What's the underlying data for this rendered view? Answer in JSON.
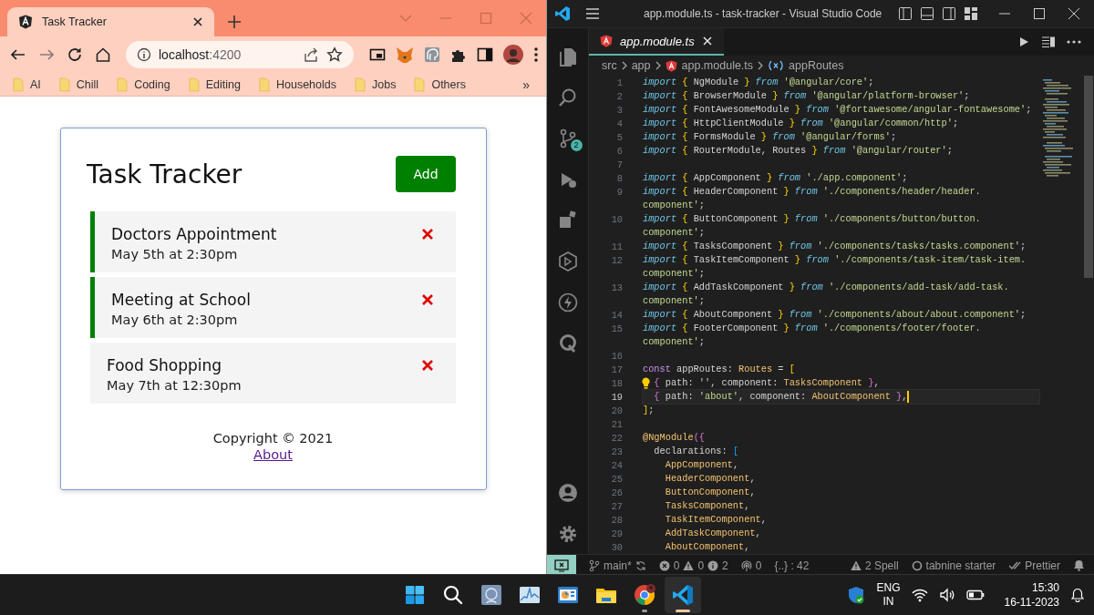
{
  "browser": {
    "tab": {
      "title": "Task Tracker"
    },
    "address": {
      "host": "localhost",
      "port": ":4200"
    },
    "bookmarks": [
      {
        "label": "AI"
      },
      {
        "label": "Chill"
      },
      {
        "label": "Coding"
      },
      {
        "label": "Editing"
      },
      {
        "label": "Households"
      },
      {
        "label": "Jobs"
      },
      {
        "label": "Others"
      }
    ],
    "bookmarks_more": "»",
    "app": {
      "title": "Task Tracker",
      "add_button": "Add",
      "tasks": [
        {
          "title": "Doctors Appointment",
          "date": "May 5th at 2:30pm",
          "reminder": true
        },
        {
          "title": "Meeting at School",
          "date": "May 6th at 2:30pm",
          "reminder": true
        },
        {
          "title": "Food Shopping",
          "date": "May 7th at 12:30pm",
          "reminder": false
        }
      ],
      "copyright": "Copyright © 2021",
      "about_link": "About"
    }
  },
  "vscode": {
    "title": "app.module.ts - task-tracker - Visual Studio Code",
    "scm_badge": "2",
    "tab": {
      "title": "app.module.ts"
    },
    "breadcrumbs": [
      {
        "label": "src",
        "kind": "folder"
      },
      {
        "label": "app",
        "kind": "folder"
      },
      {
        "label": "app.module.ts",
        "kind": "file"
      },
      {
        "label": "appRoutes",
        "kind": "symbol"
      }
    ],
    "editor": {
      "rows": [
        {
          "number": "1",
          "current": false,
          "lightbulb": false,
          "tokens": [
            {
              "kind": "keyword",
              "text": "import "
            },
            {
              "kind": "brace",
              "text": "{ "
            },
            {
              "kind": "plain",
              "text": "NgModule "
            },
            {
              "kind": "brace",
              "text": "} "
            },
            {
              "kind": "keyword",
              "text": "from "
            },
            {
              "kind": "string",
              "text": "'@angular/core'"
            },
            {
              "kind": "plain",
              "text": ";"
            }
          ]
        },
        {
          "number": "2",
          "current": false,
          "lightbulb": false,
          "tokens": [
            {
              "kind": "keyword",
              "text": "import "
            },
            {
              "kind": "brace",
              "text": "{ "
            },
            {
              "kind": "plain",
              "text": "BrowserModule "
            },
            {
              "kind": "brace",
              "text": "} "
            },
            {
              "kind": "keyword",
              "text": "from "
            },
            {
              "kind": "string",
              "text": "'@angular/platform-browser'"
            },
            {
              "kind": "plain",
              "text": ";"
            }
          ]
        },
        {
          "number": "3",
          "current": false,
          "lightbulb": false,
          "tokens": [
            {
              "kind": "keyword",
              "text": "import "
            },
            {
              "kind": "brace",
              "text": "{ "
            },
            {
              "kind": "plain",
              "text": "FontAwesomeModule "
            },
            {
              "kind": "brace",
              "text": "} "
            },
            {
              "kind": "keyword",
              "text": "from "
            },
            {
              "kind": "string",
              "text": "'@fortawesome/angular-fontawesome'"
            },
            {
              "kind": "plain",
              "text": ";"
            }
          ]
        },
        {
          "number": "4",
          "current": false,
          "lightbulb": false,
          "tokens": [
            {
              "kind": "keyword",
              "text": "import "
            },
            {
              "kind": "brace",
              "text": "{ "
            },
            {
              "kind": "plain",
              "text": "HttpClientModule "
            },
            {
              "kind": "brace",
              "text": "} "
            },
            {
              "kind": "keyword",
              "text": "from "
            },
            {
              "kind": "string",
              "text": "'@angular/common/http'"
            },
            {
              "kind": "plain",
              "text": ";"
            }
          ]
        },
        {
          "number": "5",
          "current": false,
          "lightbulb": false,
          "tokens": [
            {
              "kind": "keyword",
              "text": "import "
            },
            {
              "kind": "brace",
              "text": "{ "
            },
            {
              "kind": "plain",
              "text": "FormsModule "
            },
            {
              "kind": "brace",
              "text": "} "
            },
            {
              "kind": "keyword",
              "text": "from "
            },
            {
              "kind": "string",
              "text": "'@angular/forms'"
            },
            {
              "kind": "plain",
              "text": ";"
            }
          ]
        },
        {
          "number": "6",
          "current": false,
          "lightbulb": false,
          "tokens": [
            {
              "kind": "keyword",
              "text": "import "
            },
            {
              "kind": "brace",
              "text": "{ "
            },
            {
              "kind": "plain",
              "text": "RouterModule, Routes "
            },
            {
              "kind": "brace",
              "text": "} "
            },
            {
              "kind": "keyword",
              "text": "from "
            },
            {
              "kind": "string",
              "text": "'@angular/router'"
            },
            {
              "kind": "plain",
              "text": ";"
            }
          ]
        },
        {
          "number": "7",
          "current": false
        },
        {
          "number": "8",
          "current": false,
          "lightbulb": false,
          "tokens": [
            {
              "kind": "keyword",
              "text": "import "
            },
            {
              "kind": "brace",
              "text": "{ "
            },
            {
              "kind": "plain",
              "text": "AppComponent "
            },
            {
              "kind": "brace",
              "text": "} "
            },
            {
              "kind": "keyword",
              "text": "from "
            },
            {
              "kind": "string",
              "text": "'./app.component'"
            },
            {
              "kind": "plain",
              "text": ";"
            }
          ]
        },
        {
          "number": "9",
          "current": false,
          "lightbulb": false,
          "tokens": [
            {
              "kind": "keyword",
              "text": "import "
            },
            {
              "kind": "brace",
              "text": "{ "
            },
            {
              "kind": "plain",
              "text": "HeaderComponent "
            },
            {
              "kind": "brace",
              "text": "} "
            },
            {
              "kind": "keyword",
              "text": "from "
            },
            {
              "kind": "string",
              "text": "'./components/header/header."
            }
          ]
        },
        {
          "current": false,
          "lightbulb": false,
          "tokens": [
            {
              "kind": "string",
              "text": "component'"
            },
            {
              "kind": "plain",
              "text": ";"
            }
          ]
        },
        {
          "number": "10",
          "current": false,
          "lightbulb": false,
          "tokens": [
            {
              "kind": "keyword",
              "text": "import "
            },
            {
              "kind": "brace",
              "text": "{ "
            },
            {
              "kind": "plain",
              "text": "ButtonComponent "
            },
            {
              "kind": "brace",
              "text": "} "
            },
            {
              "kind": "keyword",
              "text": "from "
            },
            {
              "kind": "string",
              "text": "'./components/button/button."
            }
          ]
        },
        {
          "current": false,
          "lightbulb": false,
          "tokens": [
            {
              "kind": "string",
              "text": "component'"
            },
            {
              "kind": "plain",
              "text": ";"
            }
          ]
        },
        {
          "number": "11",
          "current": false,
          "lightbulb": false,
          "tokens": [
            {
              "kind": "keyword",
              "text": "import "
            },
            {
              "kind": "brace",
              "text": "{ "
            },
            {
              "kind": "plain",
              "text": "TasksComponent "
            },
            {
              "kind": "brace",
              "text": "} "
            },
            {
              "kind": "keyword",
              "text": "from "
            },
            {
              "kind": "string",
              "text": "'./components/tasks/tasks.component'"
            },
            {
              "kind": "plain",
              "text": ";"
            }
          ]
        },
        {
          "number": "12",
          "current": false,
          "lightbulb": false,
          "tokens": [
            {
              "kind": "keyword",
              "text": "import "
            },
            {
              "kind": "brace",
              "text": "{ "
            },
            {
              "kind": "plain",
              "text": "TaskItemComponent "
            },
            {
              "kind": "brace",
              "text": "} "
            },
            {
              "kind": "keyword",
              "text": "from "
            },
            {
              "kind": "string",
              "text": "'./components/task-item/task-item."
            }
          ]
        },
        {
          "current": false,
          "lightbulb": false,
          "tokens": [
            {
              "kind": "string",
              "text": "component'"
            },
            {
              "kind": "plain",
              "text": ";"
            }
          ]
        },
        {
          "number": "13",
          "current": false,
          "lightbulb": false,
          "tokens": [
            {
              "kind": "keyword",
              "text": "import "
            },
            {
              "kind": "brace",
              "text": "{ "
            },
            {
              "kind": "plain",
              "text": "AddTaskComponent "
            },
            {
              "kind": "brace",
              "text": "} "
            },
            {
              "kind": "keyword",
              "text": "from "
            },
            {
              "kind": "string",
              "text": "'./components/add-task/add-task."
            }
          ]
        },
        {
          "current": false,
          "lightbulb": false,
          "tokens": [
            {
              "kind": "string",
              "text": "component'"
            },
            {
              "kind": "plain",
              "text": ";"
            }
          ]
        },
        {
          "number": "14",
          "current": false,
          "lightbulb": false,
          "tokens": [
            {
              "kind": "keyword",
              "text": "import "
            },
            {
              "kind": "brace",
              "text": "{ "
            },
            {
              "kind": "plain",
              "text": "AboutComponent "
            },
            {
              "kind": "brace",
              "text": "} "
            },
            {
              "kind": "keyword",
              "text": "from "
            },
            {
              "kind": "string",
              "text": "'./components/about/about.component'"
            },
            {
              "kind": "plain",
              "text": ";"
            }
          ]
        },
        {
          "number": "15",
          "current": false,
          "lightbulb": false,
          "tokens": [
            {
              "kind": "keyword",
              "text": "import "
            },
            {
              "kind": "brace",
              "text": "{ "
            },
            {
              "kind": "plain",
              "text": "FooterComponent "
            },
            {
              "kind": "brace",
              "text": "} "
            },
            {
              "kind": "keyword",
              "text": "from "
            },
            {
              "kind": "string",
              "text": "'./components/footer/footer."
            }
          ]
        },
        {
          "current": false,
          "lightbulb": false,
          "tokens": [
            {
              "kind": "string",
              "text": "component'"
            },
            {
              "kind": "plain",
              "text": ";"
            }
          ]
        },
        {
          "number": "16",
          "current": false
        },
        {
          "number": "17",
          "current": false,
          "lightbulb": false,
          "tokens": [
            {
              "kind": "storage",
              "text": "const "
            },
            {
              "kind": "plain",
              "text": "appRoutes: "
            },
            {
              "kind": "type",
              "text": "Routes "
            },
            {
              "kind": "plain",
              "text": "= "
            },
            {
              "kind": "brace",
              "text": "["
            }
          ]
        },
        {
          "number": "18",
          "current": false,
          "lightbulb": true,
          "tokens": [
            {
              "kind": "brace2",
              "text": "  { "
            },
            {
              "kind": "plain",
              "text": "path: "
            },
            {
              "kind": "string",
              "text": "''"
            },
            {
              "kind": "plain",
              "text": ", component: "
            },
            {
              "kind": "type",
              "text": "TasksComponent "
            },
            {
              "kind": "brace2",
              "text": "}"
            },
            {
              "kind": "plain",
              "text": ","
            }
          ]
        },
        {
          "number": "19",
          "current": true,
          "lightbulb": false,
          "tokens": [
            {
              "kind": "brace2",
              "text": "  { "
            },
            {
              "kind": "plain",
              "text": "path: "
            },
            {
              "kind": "string",
              "text": "'about'"
            },
            {
              "kind": "plain",
              "text": ", component: "
            },
            {
              "kind": "type",
              "text": "AboutComponent "
            },
            {
              "kind": "brace2",
              "text": "}"
            },
            {
              "kind": "plain",
              "text": ","
            }
          ]
        },
        {
          "number": "20",
          "current": false,
          "lightbulb": false,
          "tokens": [
            {
              "kind": "brace",
              "text": "]"
            },
            {
              "kind": "plain",
              "text": ";"
            }
          ]
        },
        {
          "number": "21",
          "current": false
        },
        {
          "number": "22",
          "current": false,
          "lightbulb": false,
          "tokens": [
            {
              "kind": "decorator",
              "text": "@NgModule"
            },
            {
              "kind": "brace2",
              "text": "({"
            }
          ]
        },
        {
          "number": "23",
          "current": false,
          "lightbulb": false,
          "tokens": [
            {
              "kind": "plain",
              "text": "  declarations: "
            },
            {
              "kind": "brace3",
              "text": "["
            }
          ]
        },
        {
          "number": "24",
          "current": false,
          "lightbulb": false,
          "tokens": [
            {
              "kind": "type",
              "text": "    AppComponent"
            },
            {
              "kind": "plain",
              "text": ","
            }
          ]
        },
        {
          "number": "25",
          "current": false,
          "lightbulb": false,
          "tokens": [
            {
              "kind": "type",
              "text": "    HeaderComponent"
            },
            {
              "kind": "plain",
              "text": ","
            }
          ]
        },
        {
          "number": "26",
          "current": false,
          "lightbulb": false,
          "tokens": [
            {
              "kind": "type",
              "text": "    ButtonComponent"
            },
            {
              "kind": "plain",
              "text": ","
            }
          ]
        },
        {
          "number": "27",
          "current": false,
          "lightbulb": false,
          "tokens": [
            {
              "kind": "type",
              "text": "    TasksComponent"
            },
            {
              "kind": "plain",
              "text": ","
            }
          ]
        },
        {
          "number": "28",
          "current": false,
          "lightbulb": false,
          "tokens": [
            {
              "kind": "type",
              "text": "    TaskItemComponent"
            },
            {
              "kind": "plain",
              "text": ","
            }
          ]
        },
        {
          "number": "29",
          "current": false,
          "lightbulb": false,
          "tokens": [
            {
              "kind": "type",
              "text": "    AddTaskComponent"
            },
            {
              "kind": "plain",
              "text": ","
            }
          ]
        },
        {
          "number": "30",
          "current": false,
          "lightbulb": false,
          "tokens": [
            {
              "kind": "type",
              "text": "    AboutComponent"
            },
            {
              "kind": "plain",
              "text": ","
            }
          ]
        }
      ]
    },
    "status_bar": {
      "branch": "main*",
      "errors": "0",
      "warnings": "0",
      "infos": "2",
      "ports": "0",
      "selection": "{..} : 42",
      "spell": "2 Spell",
      "tabnine": "tabnine starter",
      "formatter": "Prettier"
    }
  },
  "taskbar": {
    "apps": [
      {
        "kind": "start",
        "running": false,
        "active": false
      },
      {
        "kind": "search",
        "running": false,
        "active": false
      },
      {
        "kind": "profile",
        "running": false,
        "active": false
      },
      {
        "kind": "monitor",
        "running": false,
        "active": false
      },
      {
        "kind": "dashboard",
        "running": false,
        "active": false
      },
      {
        "kind": "files",
        "running": false,
        "active": false
      },
      {
        "kind": "browser",
        "running": true,
        "active": false
      },
      {
        "kind": "editor",
        "running": true,
        "active": true
      }
    ],
    "language": "ENG",
    "region": "IN",
    "time": "15:30",
    "date": "16-11-2023"
  }
}
